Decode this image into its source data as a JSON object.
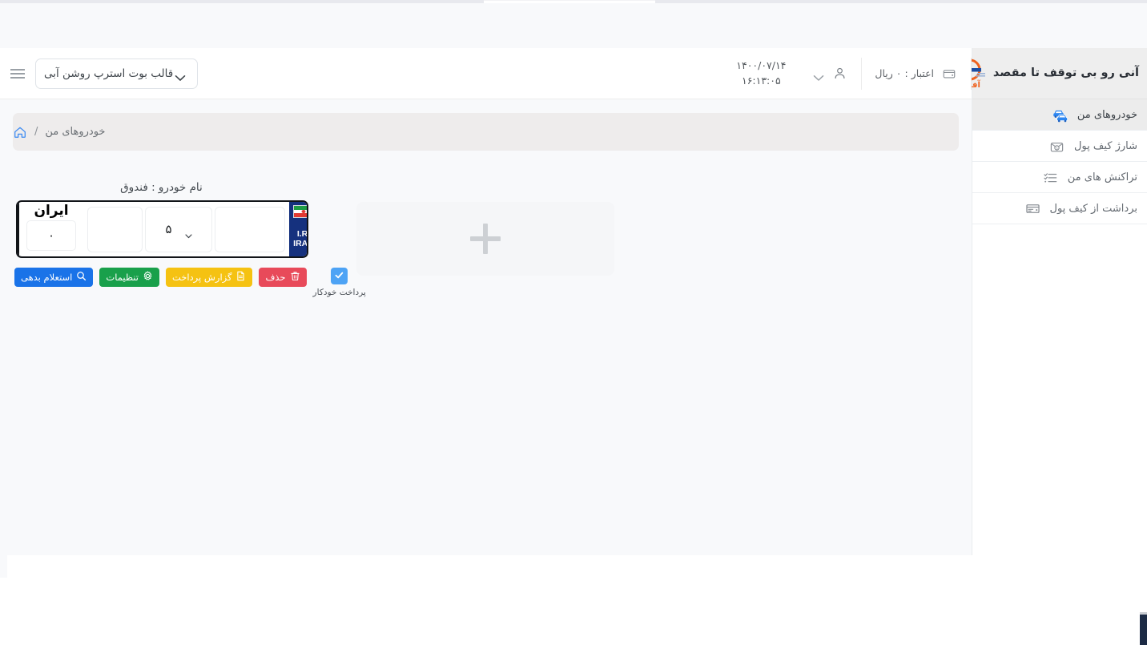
{
  "brand": {
    "title": "آنی رو بی توقف تا مقصد",
    "logo_icon": "afro-logo-icon",
    "logo_text": "آفـرو"
  },
  "sidebar": {
    "items": [
      {
        "label": "خودروهای من",
        "icon": "two-cars-icon",
        "active": true
      },
      {
        "label": "شارژ کیف پول",
        "icon": "wallet-charge-icon",
        "active": false
      },
      {
        "label": "تراکنش های من",
        "icon": "transactions-list-icon",
        "active": false
      },
      {
        "label": "برداشت از کیف پول",
        "icon": "wallet-withdraw-icon",
        "active": false
      }
    ]
  },
  "topbar": {
    "menu_icon": "hamburger-menu-icon",
    "theme_select": {
      "value": "قالب بوت استرپ روشن آبی",
      "chevron_icon": "chevron-down-icon"
    },
    "credit": {
      "text": "اعتبار : ۰ ریال",
      "icon": "wallet-card-icon"
    },
    "user": {
      "icon": "user-avatar-icon",
      "chevron_icon": "chevron-down-icon"
    },
    "datetime": {
      "date": "۱۴۰۰/۰۷/۱۴",
      "time": "۱۶:۱۳:۰۵"
    }
  },
  "breadcrumb": {
    "home_icon": "home-icon",
    "separator": "/",
    "current": "خودروهای من"
  },
  "vehicle": {
    "name_label": "نام خودرو : فندوق",
    "plate": {
      "iran_word": "ایران",
      "iran_value": "۰",
      "region_value": "",
      "letter_value": "۵",
      "letter_chevron_icon": "chevron-down-icon",
      "serial_value": "",
      "country_strip": {
        "flag_icon": "iran-flag-icon",
        "line1": "I.R.",
        "line2": "IRAN"
      }
    },
    "actions": [
      {
        "label": "استعلام بدهی",
        "icon": "search-icon",
        "color": "#1a73e8"
      },
      {
        "label": "تنظیمات",
        "icon": "gear-icon",
        "color": "#19a04b"
      },
      {
        "label": "گزارش پرداخت",
        "icon": "document-report-icon",
        "color": "#f5c212"
      },
      {
        "label": "حذف",
        "icon": "trash-icon",
        "color": "#e84a5a"
      }
    ],
    "autopay": {
      "label": "پرداخت خودکار",
      "checked": true,
      "check_icon": "checkmark-icon"
    }
  },
  "add_vehicle": {
    "icon": "plus-icon",
    "label": ""
  },
  "colors": {
    "accent_blue": "#1a73e8",
    "green": "#19a04b",
    "yellow": "#f5c212",
    "red": "#e84a5a",
    "page_bg": "#f8f9fb",
    "breadcrumb_bg": "#eeecec",
    "brand_orange": "#ef6320"
  }
}
